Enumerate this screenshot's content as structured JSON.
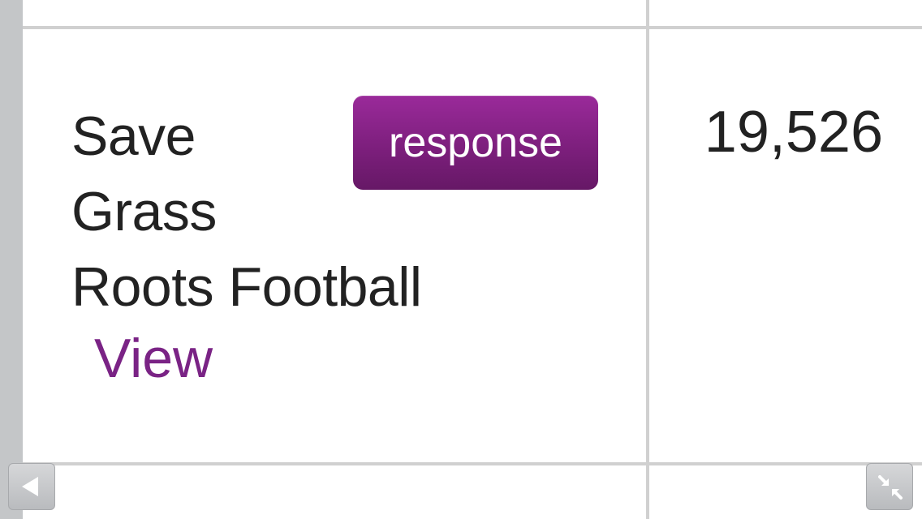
{
  "petition": {
    "title_lines": [
      "Save",
      "Grass",
      "Roots Football"
    ],
    "view_label": "View",
    "response_label": "response",
    "signature_count": "19,526"
  },
  "controls": {
    "back_icon": "triangle-left-icon",
    "collapse_icon": "collapse-arrows-icon"
  },
  "colors": {
    "accent_purple": "#7a2385",
    "badge_gradient_top": "#9a2a9a",
    "badge_gradient_bottom": "#661866",
    "text": "#222222",
    "grid_line": "#d0d0d0",
    "rail": "#c4c6c8"
  }
}
